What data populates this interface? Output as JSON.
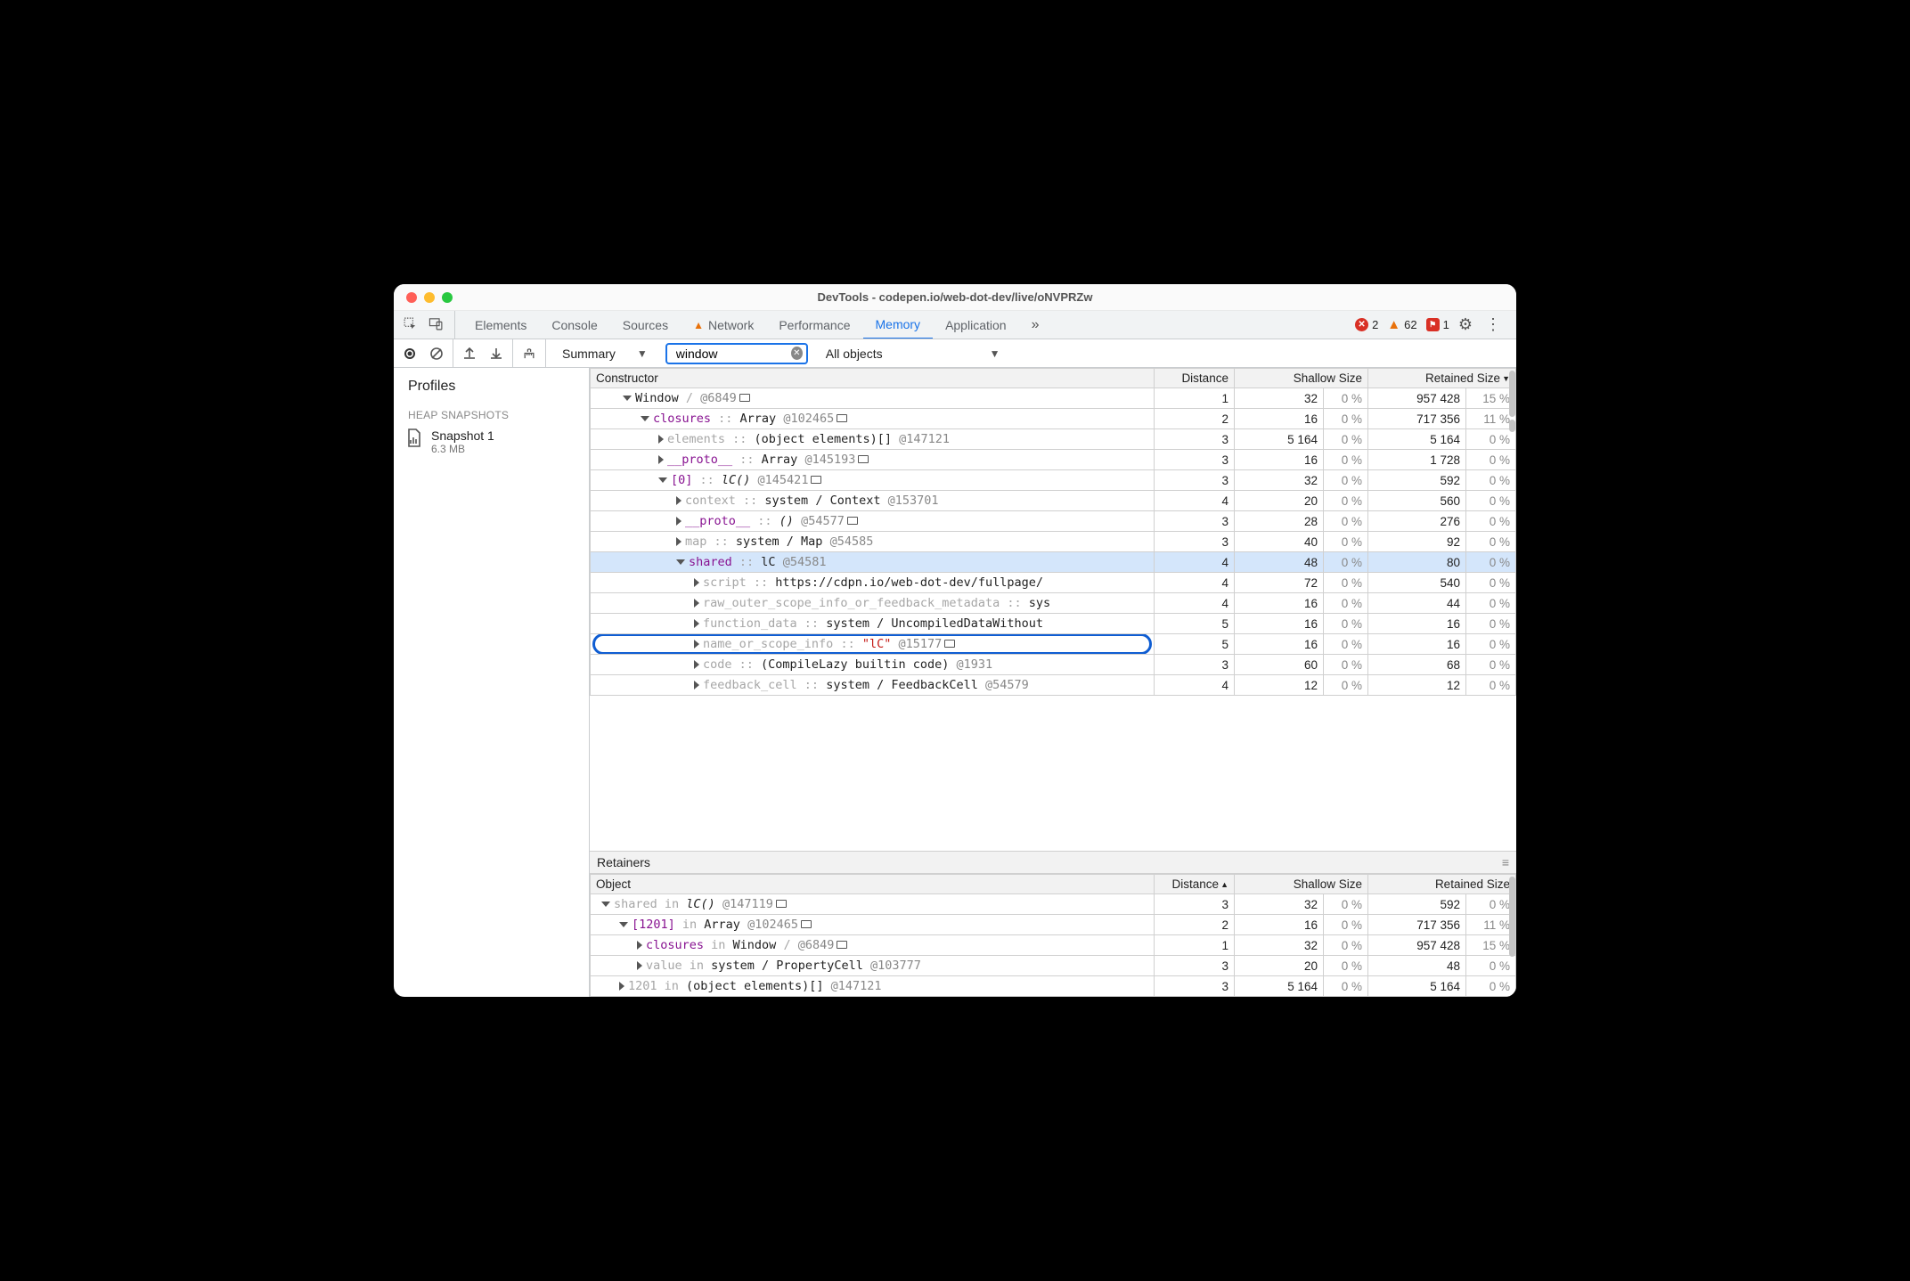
{
  "window_title": "DevTools - codepen.io/web-dot-dev/live/oNVPRZw",
  "tabs": [
    "Elements",
    "Console",
    "Sources",
    "Network",
    "Performance",
    "Memory",
    "Application"
  ],
  "active_tab": "Memory",
  "network_has_warning": true,
  "counters": {
    "errors": 2,
    "warnings": 62,
    "issues": 1
  },
  "toolbar": {
    "view_mode": "Summary",
    "filter_value": "window",
    "object_filter": "All objects"
  },
  "sidebar": {
    "title": "Profiles",
    "section": "HEAP SNAPSHOTS",
    "items": [
      {
        "name": "Snapshot 1",
        "size": "6.3 MB"
      }
    ]
  },
  "grid_headers": {
    "constructor": "Constructor",
    "object": "Object",
    "distance": "Distance",
    "shallow": "Shallow Size",
    "retained": "Retained Size"
  },
  "rows": [
    {
      "indent": 0,
      "exp": true,
      "segments": [
        {
          "t": "Window",
          "c": ""
        },
        {
          "t": " / ",
          "c": "gray"
        },
        {
          "t": "  @6849",
          "c": "objid"
        }
      ],
      "box": true,
      "dist": "1",
      "shal": "32",
      "shalp": "0 %",
      "ret": "957 428",
      "retp": "15 %"
    },
    {
      "indent": 1,
      "exp": true,
      "segments": [
        {
          "t": "closures",
          "c": "purple"
        },
        {
          "t": " :: ",
          "c": "gray"
        },
        {
          "t": "Array ",
          "c": ""
        },
        {
          "t": "@102465",
          "c": "objid"
        }
      ],
      "box": true,
      "dist": "2",
      "shal": "16",
      "shalp": "0 %",
      "ret": "717 356",
      "retp": "11 %"
    },
    {
      "indent": 2,
      "exp": false,
      "segments": [
        {
          "t": "elements",
          "c": "gray"
        },
        {
          "t": " :: ",
          "c": "gray"
        },
        {
          "t": "(object elements)[] ",
          "c": ""
        },
        {
          "t": "@147121",
          "c": "objid"
        }
      ],
      "dist": "3",
      "shal": "5 164",
      "shalp": "0 %",
      "ret": "5 164",
      "retp": "0 %"
    },
    {
      "indent": 2,
      "exp": false,
      "segments": [
        {
          "t": "__proto__",
          "c": "purple"
        },
        {
          "t": " :: ",
          "c": "gray"
        },
        {
          "t": "Array ",
          "c": ""
        },
        {
          "t": "@145193",
          "c": "objid"
        }
      ],
      "box": true,
      "dist": "3",
      "shal": "16",
      "shalp": "0 %",
      "ret": "1 728",
      "retp": "0 %"
    },
    {
      "indent": 2,
      "exp": true,
      "segments": [
        {
          "t": "[0]",
          "c": "purple"
        },
        {
          "t": " :: ",
          "c": "gray"
        },
        {
          "t": "lC() ",
          "c": "name-ital"
        },
        {
          "t": "@145421",
          "c": "objid"
        }
      ],
      "box": true,
      "dist": "3",
      "shal": "32",
      "shalp": "0 %",
      "ret": "592",
      "retp": "0 %"
    },
    {
      "indent": 3,
      "exp": false,
      "segments": [
        {
          "t": "context",
          "c": "gray"
        },
        {
          "t": " :: ",
          "c": "gray"
        },
        {
          "t": "system / Context ",
          "c": ""
        },
        {
          "t": "@153701",
          "c": "objid"
        }
      ],
      "dist": "4",
      "shal": "20",
      "shalp": "0 %",
      "ret": "560",
      "retp": "0 %"
    },
    {
      "indent": 3,
      "exp": false,
      "segments": [
        {
          "t": "__proto__",
          "c": "purple"
        },
        {
          "t": " :: ",
          "c": "gray"
        },
        {
          "t": "() ",
          "c": "name-ital"
        },
        {
          "t": "@54577",
          "c": "objid"
        }
      ],
      "box": true,
      "dist": "3",
      "shal": "28",
      "shalp": "0 %",
      "ret": "276",
      "retp": "0 %"
    },
    {
      "indent": 3,
      "exp": false,
      "segments": [
        {
          "t": "map",
          "c": "gray"
        },
        {
          "t": " :: ",
          "c": "gray"
        },
        {
          "t": "system / Map ",
          "c": ""
        },
        {
          "t": "@54585",
          "c": "objid"
        }
      ],
      "dist": "3",
      "shal": "40",
      "shalp": "0 %",
      "ret": "92",
      "retp": "0 %"
    },
    {
      "indent": 3,
      "exp": true,
      "selected": true,
      "segments": [
        {
          "t": "shared",
          "c": "purple"
        },
        {
          "t": " :: ",
          "c": "gray"
        },
        {
          "t": "lC ",
          "c": ""
        },
        {
          "t": "@54581",
          "c": "objid"
        }
      ],
      "dist": "4",
      "shal": "48",
      "shalp": "0 %",
      "ret": "80",
      "retp": "0 %"
    },
    {
      "indent": 4,
      "exp": false,
      "segments": [
        {
          "t": "script",
          "c": "gray"
        },
        {
          "t": " :: ",
          "c": "gray"
        },
        {
          "t": "https://cdpn.io/web-dot-dev/fullpage/",
          "c": ""
        }
      ],
      "dist": "4",
      "shal": "72",
      "shalp": "0 %",
      "ret": "540",
      "retp": "0 %"
    },
    {
      "indent": 4,
      "exp": false,
      "segments": [
        {
          "t": "raw_outer_scope_info_or_feedback_metadata",
          "c": "gray"
        },
        {
          "t": " :: ",
          "c": "gray"
        },
        {
          "t": "sys",
          "c": ""
        }
      ],
      "dist": "4",
      "shal": "16",
      "shalp": "0 %",
      "ret": "44",
      "retp": "0 %"
    },
    {
      "indent": 4,
      "exp": false,
      "segments": [
        {
          "t": "function_data",
          "c": "gray"
        },
        {
          "t": " :: ",
          "c": "gray"
        },
        {
          "t": "system / UncompiledDataWithout",
          "c": ""
        }
      ],
      "dist": "5",
      "shal": "16",
      "shalp": "0 %",
      "ret": "16",
      "retp": "0 %"
    },
    {
      "indent": 4,
      "exp": false,
      "highlight": true,
      "segments": [
        {
          "t": "name_or_scope_info",
          "c": "gray"
        },
        {
          "t": " :: ",
          "c": "gray"
        },
        {
          "t": "\"lC\"",
          "c": "red"
        },
        {
          "t": " @15177",
          "c": "objid"
        }
      ],
      "box": true,
      "dist": "5",
      "shal": "16",
      "shalp": "0 %",
      "ret": "16",
      "retp": "0 %"
    },
    {
      "indent": 4,
      "exp": false,
      "segments": [
        {
          "t": "code",
          "c": "gray"
        },
        {
          "t": " :: ",
          "c": "gray"
        },
        {
          "t": "(CompileLazy builtin code) ",
          "c": ""
        },
        {
          "t": "@1931",
          "c": "objid"
        }
      ],
      "dist": "3",
      "shal": "60",
      "shalp": "0 %",
      "ret": "68",
      "retp": "0 %"
    },
    {
      "indent": 4,
      "exp": false,
      "segments": [
        {
          "t": "feedback_cell",
          "c": "gray"
        },
        {
          "t": " :: ",
          "c": "gray"
        },
        {
          "t": "system / FeedbackCell ",
          "c": ""
        },
        {
          "t": "@54579",
          "c": "objid"
        }
      ],
      "dist": "4",
      "shal": "12",
      "shalp": "0 %",
      "ret": "12",
      "retp": "0 %"
    }
  ],
  "retainers_label": "Retainers",
  "retainer_rows": [
    {
      "indent": 0,
      "exp": true,
      "segments": [
        {
          "t": "shared",
          "c": "gray"
        },
        {
          "t": " in ",
          "c": "gray"
        },
        {
          "t": "lC() ",
          "c": "name-ital"
        },
        {
          "t": "@147119",
          "c": "objid"
        }
      ],
      "box": true,
      "dist": "3",
      "shal": "32",
      "shalp": "0 %",
      "ret": "592",
      "retp": "0 %"
    },
    {
      "indent": 1,
      "exp": true,
      "segments": [
        {
          "t": "[1201]",
          "c": "purple"
        },
        {
          "t": " in ",
          "c": "gray"
        },
        {
          "t": "Array ",
          "c": ""
        },
        {
          "t": "@102465",
          "c": "objid"
        }
      ],
      "box": true,
      "dist": "2",
      "shal": "16",
      "shalp": "0 %",
      "ret": "717 356",
      "retp": "11 %"
    },
    {
      "indent": 2,
      "exp": false,
      "segments": [
        {
          "t": "closures",
          "c": "purple"
        },
        {
          "t": " in ",
          "c": "gray"
        },
        {
          "t": "Window",
          "c": ""
        },
        {
          "t": " / ",
          "c": "gray"
        },
        {
          "t": "  @6849",
          "c": "objid"
        }
      ],
      "box": true,
      "dist": "1",
      "shal": "32",
      "shalp": "0 %",
      "ret": "957 428",
      "retp": "15 %"
    },
    {
      "indent": 2,
      "exp": false,
      "segments": [
        {
          "t": "value",
          "c": "gray"
        },
        {
          "t": " in ",
          "c": "gray"
        },
        {
          "t": "system / PropertyCell ",
          "c": ""
        },
        {
          "t": "@103777",
          "c": "objid"
        }
      ],
      "dist": "3",
      "shal": "20",
      "shalp": "0 %",
      "ret": "48",
      "retp": "0 %"
    },
    {
      "indent": 1,
      "exp": false,
      "segments": [
        {
          "t": "1201",
          "c": "gray"
        },
        {
          "t": " in ",
          "c": "gray"
        },
        {
          "t": "(object elements)[] ",
          "c": ""
        },
        {
          "t": "@147121",
          "c": "objid"
        }
      ],
      "dist": "3",
      "shal": "5 164",
      "shalp": "0 %",
      "ret": "5 164",
      "retp": "0 %"
    }
  ]
}
